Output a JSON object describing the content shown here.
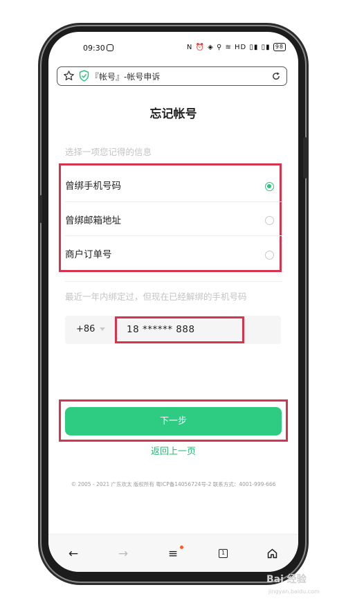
{
  "status_bar": {
    "time": "09:30",
    "icons_text": "N ⏰ ◈ ⚲ ≋ HD ▯▮ ▯▮",
    "battery": "98"
  },
  "address_bar": {
    "title": "『帐号』-帐号申诉",
    "icons": [
      "star-icon",
      "shield-check-icon",
      "reload-icon"
    ]
  },
  "page": {
    "title": "忘记帐号",
    "section_hint": "选择一项您记得的信息",
    "options": [
      {
        "label": "曾绑手机号码",
        "selected": true
      },
      {
        "label": "曾绑邮箱地址",
        "selected": false
      },
      {
        "label": "商户订单号",
        "selected": false
      }
    ],
    "phone_hint": "最近一年内绑定过，但现在已经解绑的手机号码",
    "country_code": "+86",
    "phone_value": "18 ****** 888",
    "next_button": "下一步",
    "back_link": "返回上一页",
    "footer": "© 2005 - 2021 广东欢太 版权所有 粤ICP备14056724号-2 联系方式：4001-999-666"
  },
  "bottom_nav": {
    "items": [
      "back-arrow-icon",
      "forward-arrow-icon",
      "menu-icon",
      "tabs-icon",
      "home-icon"
    ],
    "tab_count": "1"
  },
  "colors": {
    "accent": "#2dcc82",
    "annotation_red": "#d6334d"
  },
  "watermark": {
    "brand": "Bai 经验",
    "url": "jingyan.baidu.com"
  }
}
